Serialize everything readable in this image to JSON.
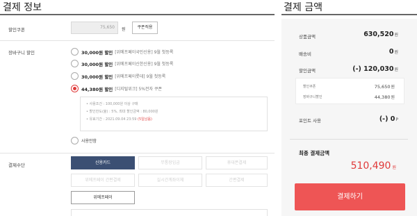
{
  "payment_info": {
    "title": "결제 정보",
    "coupon": {
      "label": "할인쿠폰",
      "amount": "75,650",
      "unit": "원",
      "apply_label": "쿠폰적용"
    },
    "cart_discount": {
      "label": "장바구니 할인",
      "options": [
        {
          "amount": "30,000원 할인",
          "text": "[위메프페이국민신용] 9월 첫등록",
          "checked": false
        },
        {
          "amount": "30,000원 할인",
          "text": "[위메프페이신한신용] 9월 첫등록",
          "checked": false
        },
        {
          "amount": "30,000원 할인",
          "text": "[위메프페이롯데] 9월 첫등록",
          "checked": false
        },
        {
          "amount": "44,380원 할인",
          "text": "[디지털위크] 5%전자 쿠폰",
          "checked": true
        }
      ],
      "details": [
        "• 사용조건 : 100,000원 이상 구매",
        "• 할인한도(율) : 5%, 최대 할인금액 : 80,000원",
        "• 유효기간 : 2021.09.04 23:59 "
      ],
      "details_highlight": "(5일남음)",
      "none_label": "사용안함"
    },
    "method": {
      "label": "결제수단",
      "options": [
        "신용카드",
        "무통장입금",
        "휴대폰결제",
        "위메프페이 간편결제",
        "실시간계좌이체",
        "간편결제",
        "위메프페이"
      ]
    }
  },
  "summary": {
    "title": "결제 금액",
    "product_label": "상품금액",
    "product_value": "630,520",
    "shipping_label": "배송비",
    "shipping_value": "0",
    "discount_label": "할인금액",
    "discount_value": "(-) 120,030",
    "coupon_sub_label": "할인쿠폰",
    "coupon_sub_value": "75,650",
    "cart_sub_label": "장바구니할인",
    "cart_sub_value": "44,380",
    "points_label": "포인트 사용",
    "points_value": "(-) 0",
    "points_unit": "P",
    "won": "원",
    "final_label": "최종 결제금액",
    "final_value": "510,490",
    "checkout_label": "결제하기"
  },
  "colors": {
    "accent_red": "#e03a3a",
    "checkout_red": "#ee5555",
    "selected_navy": "#3b4f73"
  }
}
